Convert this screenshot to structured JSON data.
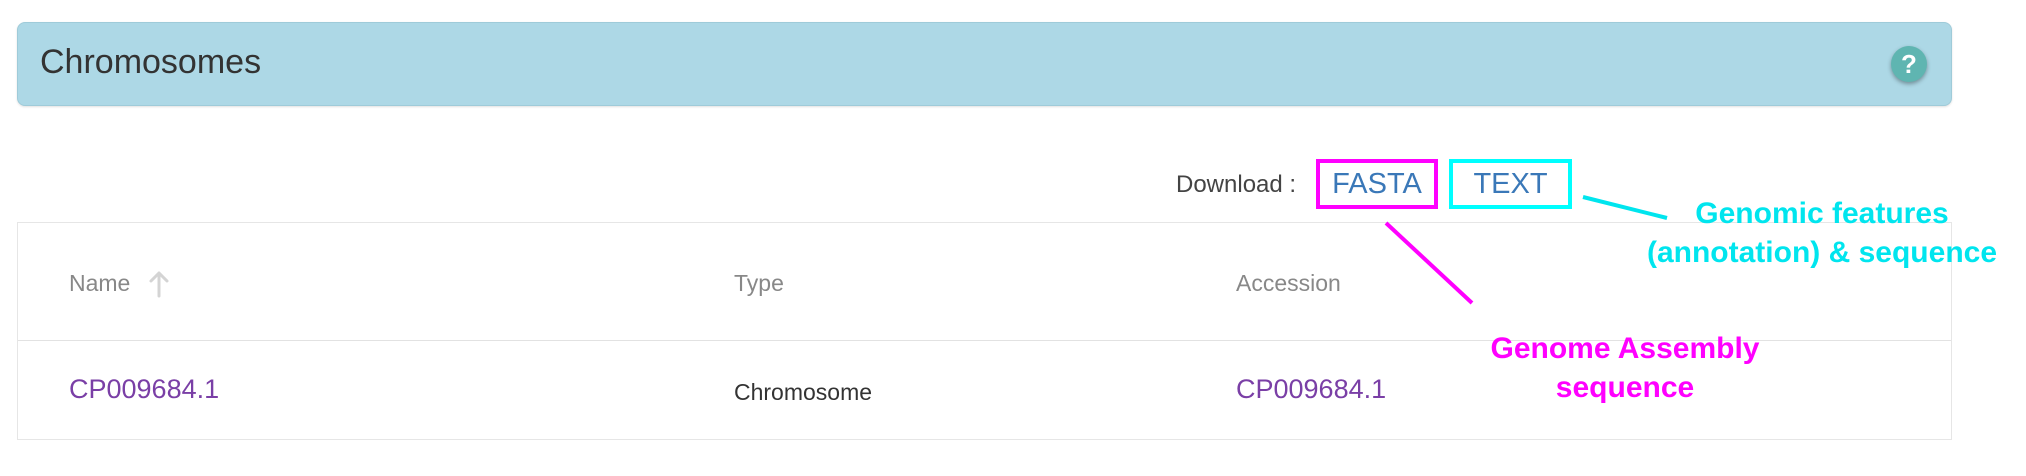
{
  "panel": {
    "title": "Chromosomes",
    "help_icon": "?"
  },
  "download": {
    "label": "Download :",
    "fasta": "FASTA",
    "text": "TEXT"
  },
  "table": {
    "columns": [
      "Name",
      "Type",
      "Accession"
    ],
    "sort_column": "Name",
    "rows": [
      {
        "name": "CP009684.1",
        "type": "Chromosome",
        "accession": "CP009684.1"
      }
    ]
  },
  "annotations": {
    "features_line1": "Genomic features",
    "features_line2": "(annotation) & sequence",
    "assembly_line1": "Genome Assembly",
    "assembly_line2": "sequence"
  },
  "colors": {
    "header_bg": "#add8e6",
    "link": "#7a3fa6",
    "fasta_highlight": "#ff00ff",
    "text_highlight": "#00ffff"
  }
}
